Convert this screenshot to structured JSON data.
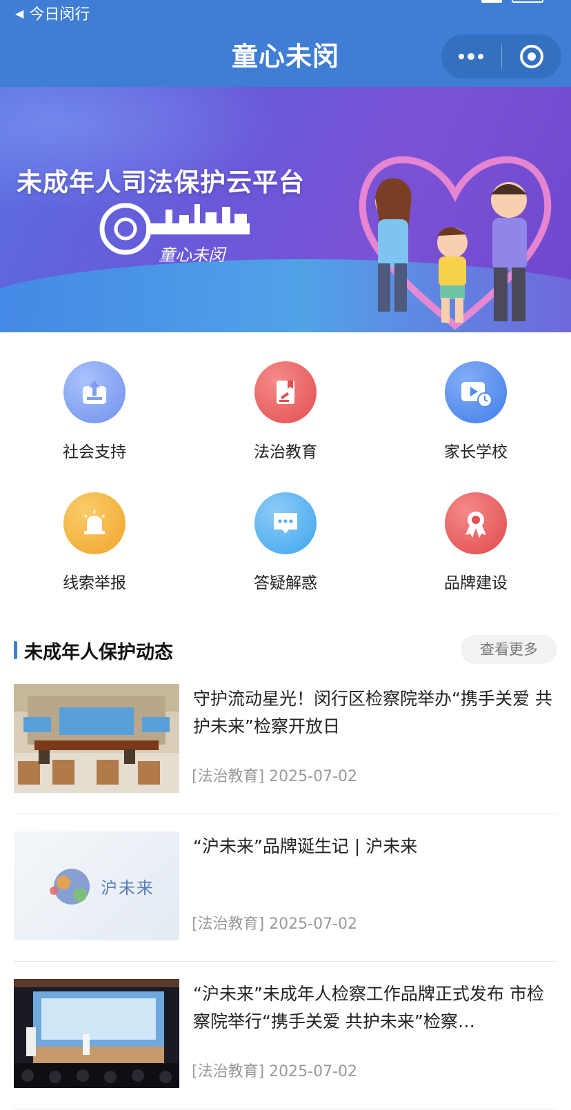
{
  "status_bar": {
    "back_label": "今日闵行"
  },
  "header": {
    "title": "童心未闵"
  },
  "banner": {
    "title": "未成年人司法保护云平台",
    "logo_text": "童心未闵"
  },
  "grid": [
    {
      "label": "社会支持",
      "icon": "upload-box-icon",
      "color": "#7e9cf0"
    },
    {
      "label": "法治教育",
      "icon": "law-book-gavel-icon",
      "color": "#ec5f5f"
    },
    {
      "label": "家长学校",
      "icon": "video-clock-icon",
      "color": "#4f8cf0"
    },
    {
      "label": "线索举报",
      "icon": "alarm-light-icon",
      "color": "#f4b136"
    },
    {
      "label": "答疑解惑",
      "icon": "chat-bubble-icon",
      "color": "#4fb3f2"
    },
    {
      "label": "品牌建设",
      "icon": "award-ribbon-icon",
      "color": "#ec5f5f"
    }
  ],
  "news_section": {
    "title": "未成年人保护动态",
    "more_label": "查看更多",
    "items": [
      {
        "title": "守护流动星光！闵行区检察院举办“携手关爱 共护未来”检察开放日",
        "meta": "[法治教育] 2025-07-02"
      },
      {
        "title": "“沪未来”品牌诞生记 | 沪未来",
        "meta": "[法治教育] 2025-07-02"
      },
      {
        "title": "“沪未来”未成年人检察工作品牌正式发布 市检察院举行“携手关爱 共护未来”检察…",
        "meta": "[法治教育] 2025-07-02"
      }
    ]
  },
  "thumb2_logo_text": "沪未来"
}
